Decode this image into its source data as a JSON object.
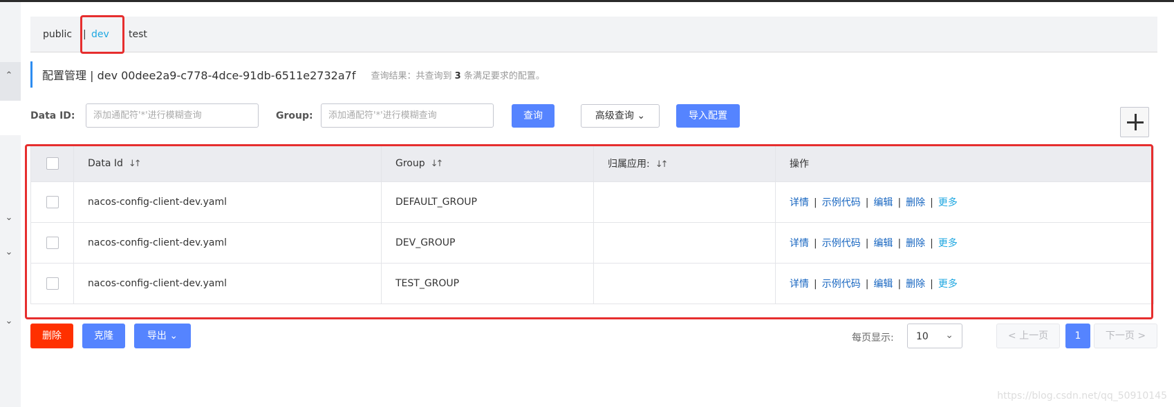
{
  "namespaces": {
    "tabs": [
      "public",
      "dev",
      "test"
    ],
    "separator": "|",
    "active": "dev"
  },
  "header": {
    "title": "配置管理 | dev 00dee2a9-c778-4dce-91db-6511e2732a7f",
    "result_prefix": "查询结果：共查询到",
    "result_count": "3",
    "result_suffix": "条满足要求的配置。"
  },
  "search": {
    "data_id_label": "Data ID:",
    "data_id_placeholder": "添加通配符'*'进行模糊查询",
    "group_label": "Group:",
    "group_placeholder": "添加通配符'*'进行模糊查询",
    "query_button": "查询",
    "advanced_button": "高级查询",
    "import_button": "导入配置"
  },
  "table": {
    "columns": [
      "Data Id",
      "Group",
      "归属应用:",
      "操作"
    ],
    "rows": [
      {
        "data_id": "nacos-config-client-dev.yaml",
        "group": "DEFAULT_GROUP",
        "app": ""
      },
      {
        "data_id": "nacos-config-client-dev.yaml",
        "group": "DEV_GROUP",
        "app": ""
      },
      {
        "data_id": "nacos-config-client-dev.yaml",
        "group": "TEST_GROUP",
        "app": ""
      }
    ],
    "actions": [
      "详情",
      "示例代码",
      "编辑",
      "删除",
      "更多"
    ]
  },
  "footer": {
    "delete_button": "删除",
    "clone_button": "克隆",
    "export_button": "导出",
    "page_size_label": "每页显示:",
    "page_size": "10",
    "prev": "上一页",
    "current_page": "1",
    "next": "下一页"
  },
  "watermark": "https://blog.csdn.net/qq_50910145",
  "colors": {
    "primary": "#5584ff",
    "danger": "#ff3000",
    "link": "#1665c0",
    "highlight": "#e62e2e"
  },
  "icons": [
    "plus-icon",
    "sort-icon",
    "chevron-down-icon",
    "chevron-up-icon",
    "chevron-left-icon",
    "chevron-right-icon"
  ]
}
